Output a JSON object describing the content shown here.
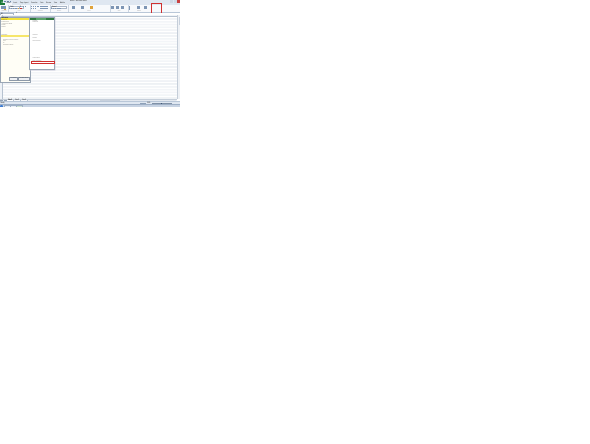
{
  "window": {
    "title": "Book1 - Microsoft Excel"
  },
  "ribbon_tabs": [
    "File",
    "Home",
    "Insert",
    "Page Layout",
    "Formulas",
    "Data",
    "Review",
    "View",
    "Add-Ins"
  ],
  "ribbon": {
    "font_name": "Calibri",
    "font_size": "11",
    "number_format": "General",
    "groups": [
      "Clipboard",
      "Font",
      "Alignment",
      "Number",
      "Styles",
      "Cells",
      "Editing"
    ]
  },
  "formula_bar": {
    "name_box": "A1",
    "fx": "fx"
  },
  "task_pane": {
    "title": "Reference",
    "rows": [
      "Search for:",
      "Search source",
      "All Reference Books",
      "Results",
      "Options",
      "Translation",
      "Translate a word or sentence",
      "From",
      "To",
      "Translation options..."
    ],
    "buttons": [
      "Get updates",
      "Research options..."
    ]
  },
  "dropdown": {
    "items": [
      "Translate",
      "Thesaurus",
      "Research",
      "Spelling",
      "New Comment",
      "Protect Sheet",
      "Share Workbook"
    ]
  },
  "sheet_tabs": [
    "Sheet1",
    "Sheet2",
    "Sheet3"
  ],
  "status": {
    "text": "Ready",
    "zoom": "100%"
  }
}
